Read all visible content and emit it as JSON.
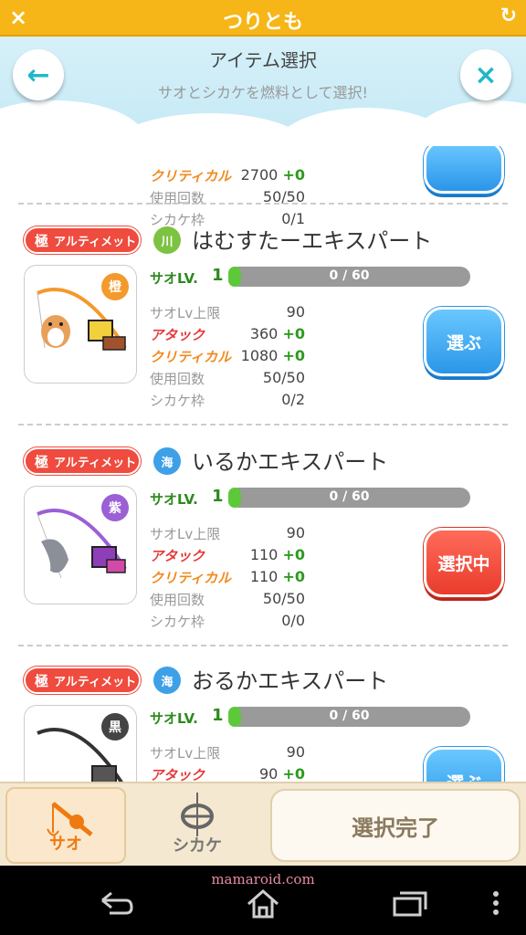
{
  "appbar": {
    "title": "つりとも",
    "close_icon": "×",
    "refresh_icon": "↻"
  },
  "header": {
    "title": "アイテム選択",
    "subtitle": "サオとシカケを燃料として選択!",
    "back_icon": "←",
    "close_icon": "×"
  },
  "colors": {
    "orange": "#f6b617",
    "green": "#2d8a1e",
    "red": "#ef4b3e",
    "blue": "#2a95e8"
  },
  "partial_card": {
    "stats": [
      {
        "label": "クリティカル",
        "value": "2700",
        "plus": "+0"
      },
      {
        "label": "使用回数",
        "value": "50/50"
      },
      {
        "label": "シカケ枠",
        "value": "0/1"
      }
    ]
  },
  "items": [
    {
      "badge_kyoku": "極",
      "badge_label": "アルティメット",
      "type_icon": "川",
      "type_color": "#7bc341",
      "name": "はむすたーエキスパート",
      "color_tag": "橙",
      "color_tag_bg": "#f39a2c",
      "lv_label": "サオLV.",
      "lv_value": "1",
      "exp_text": "0 / 60",
      "exp_fraction": 0,
      "stats": [
        {
          "label": "サオLv上限",
          "value": "90",
          "plus": ""
        },
        {
          "label": "アタック",
          "value": "360",
          "plus": "+0"
        },
        {
          "label": "クリティカル",
          "value": "1080",
          "plus": "+0"
        },
        {
          "label": "使用回数",
          "value": "50/50",
          "plus": ""
        },
        {
          "label": "シカケ枠",
          "value": "0/2",
          "plus": ""
        }
      ],
      "button": "選ぶ"
    },
    {
      "badge_kyoku": "極",
      "badge_label": "アルティメット",
      "type_icon": "海",
      "type_color": "#3ea0e6",
      "name": "いるかエキスパート",
      "color_tag": "紫",
      "color_tag_bg": "#9b5fd6",
      "lv_label": "サオLV.",
      "lv_value": "1",
      "exp_text": "0 / 60",
      "exp_fraction": 0,
      "stats": [
        {
          "label": "サオLv上限",
          "value": "90",
          "plus": ""
        },
        {
          "label": "アタック",
          "value": "110",
          "plus": "+0"
        },
        {
          "label": "クリティカル",
          "value": "110",
          "plus": "+0"
        },
        {
          "label": "使用回数",
          "value": "50/50",
          "plus": ""
        },
        {
          "label": "シカケ枠",
          "value": "0/0",
          "plus": ""
        }
      ],
      "button": "選択中"
    },
    {
      "badge_kyoku": "極",
      "badge_label": "アルティメット",
      "type_icon": "海",
      "type_color": "#3ea0e6",
      "name": "おるかエキスパート",
      "color_tag": "黒",
      "color_tag_bg": "#444444",
      "lv_label": "サオLV.",
      "lv_value": "1",
      "exp_text": "0 / 60",
      "exp_fraction": 0,
      "stats": [
        {
          "label": "サオLv上限",
          "value": "90",
          "plus": ""
        },
        {
          "label": "アタック",
          "value": "90",
          "plus": "+0"
        }
      ],
      "button": "選ぶ"
    }
  ],
  "toolbar": {
    "tab_sao": "サオ",
    "tab_shikake": "シカケ",
    "done": "選択完了"
  },
  "navbar": {
    "watermark": "mamaroid.com"
  }
}
